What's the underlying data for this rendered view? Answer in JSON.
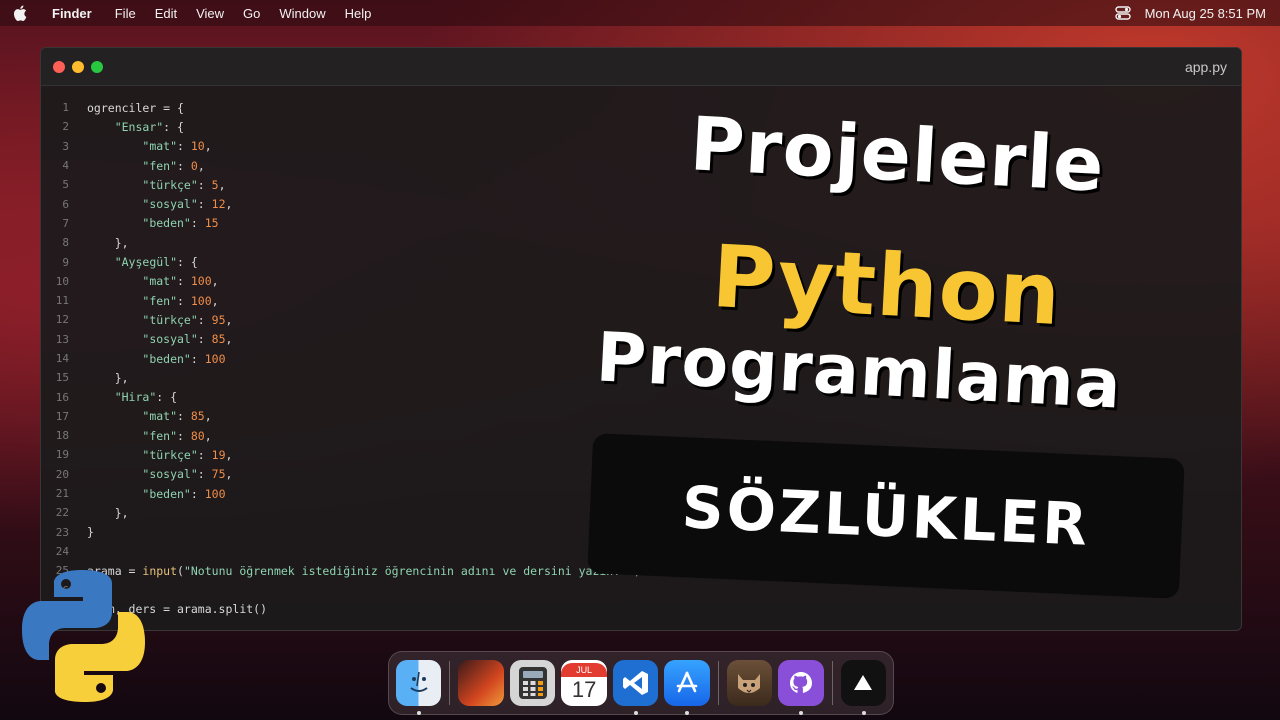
{
  "menubar": {
    "app": "Finder",
    "items": [
      "File",
      "Edit",
      "View",
      "Go",
      "Window",
      "Help"
    ],
    "clock": "Mon Aug 25  8:51 PM",
    "icons": [
      "apple-icon",
      "control-center-icon"
    ]
  },
  "editor": {
    "filename": "app.py",
    "lines": [
      {
        "n": "1"
      },
      {
        "n": "2"
      },
      {
        "n": "3"
      },
      {
        "n": "4"
      },
      {
        "n": "5"
      },
      {
        "n": "6"
      },
      {
        "n": "7"
      },
      {
        "n": "8"
      },
      {
        "n": "9"
      },
      {
        "n": "10"
      },
      {
        "n": "11"
      },
      {
        "n": "12"
      },
      {
        "n": "13"
      },
      {
        "n": "14"
      },
      {
        "n": "15"
      },
      {
        "n": "16"
      },
      {
        "n": "17"
      },
      {
        "n": "18"
      },
      {
        "n": "19"
      },
      {
        "n": "20"
      },
      {
        "n": "21"
      },
      {
        "n": "22"
      },
      {
        "n": "23"
      },
      {
        "n": "24"
      },
      {
        "n": "25"
      },
      {
        "n": "26"
      },
      {
        "n": "27"
      }
    ],
    "code": [
      "ogrenciler = {",
      "    \"Ensar\": {",
      "        \"mat\": 10,",
      "        \"fen\": 0,",
      "        \"türkçe\": 5,",
      "        \"sosyal\": 12,",
      "        \"beden\": 15",
      "    },",
      "    \"Ayşegül\": {",
      "        \"mat\": 100,",
      "        \"fen\": 100,",
      "        \"türkçe\": 95,",
      "        \"sosyal\": 85,",
      "        \"beden\": 100",
      "    },",
      "    \"Hira\": {",
      "        \"mat\": 85,",
      "        \"fen\": 80,",
      "        \"türkçe\": 19,",
      "        \"sosyal\": 75,",
      "        \"beden\": 100",
      "    },",
      "}",
      "",
      "arama = input(\"Notunu öğrenmek istediğiniz öğrencinin adını ve dersini yazın: \")",
      "",
      "isim, ders = arama.split()"
    ]
  },
  "overlay": {
    "line1": "Projelerle",
    "line2": "Python",
    "line3": "Programlama",
    "banner": "SÖZLÜKLER",
    "accent": "#f7c632"
  },
  "dock": {
    "apps": [
      {
        "name": "finder-icon",
        "running": true
      },
      {
        "name": "macos-icon",
        "running": false
      },
      {
        "name": "calculator-icon",
        "running": false
      },
      {
        "name": "calendar-icon",
        "month": "JUL",
        "day": "17",
        "running": false
      },
      {
        "name": "vscode-icon",
        "running": true
      },
      {
        "name": "app-store-icon",
        "running": true
      },
      {
        "name": "cat-app-icon",
        "running": false
      },
      {
        "name": "github-desktop-icon",
        "running": true
      },
      {
        "name": "play-app-icon",
        "running": true
      }
    ]
  }
}
